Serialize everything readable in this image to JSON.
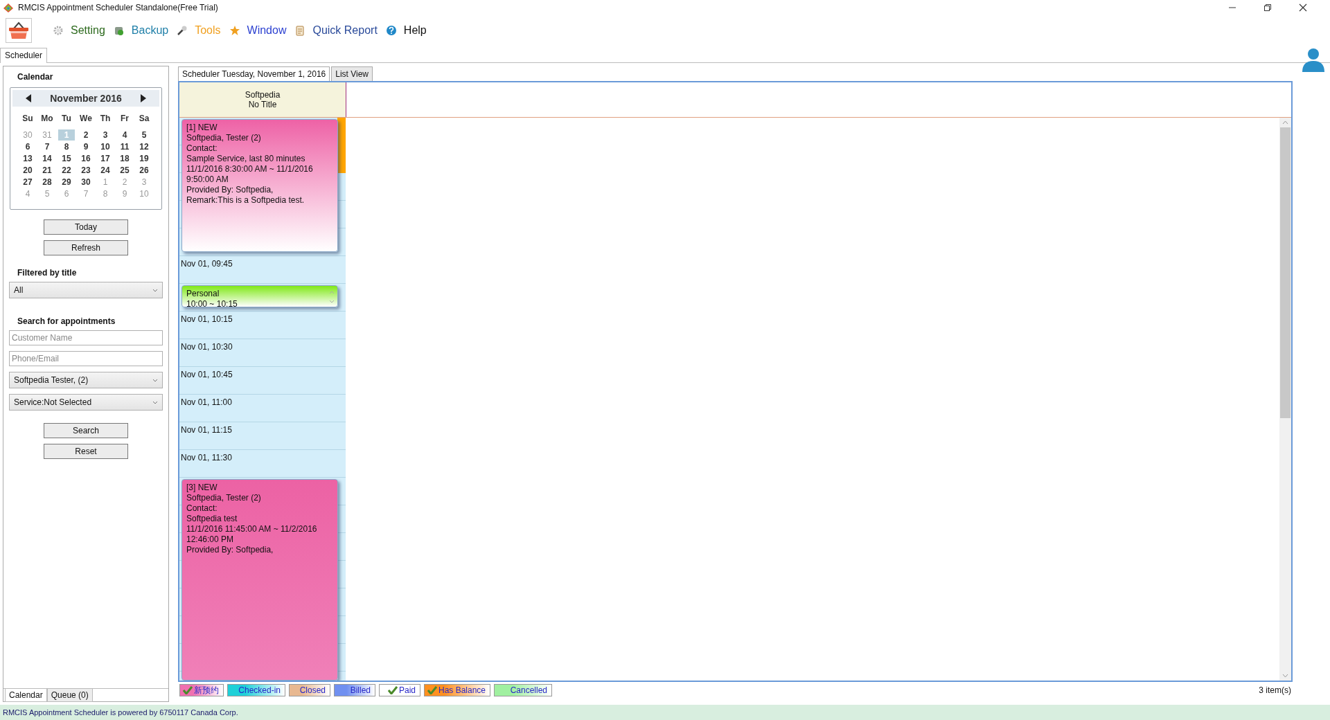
{
  "window": {
    "title": "RMCIS Appointment Scheduler Standalone(Free Trial)"
  },
  "menu": [
    {
      "label": "Setting",
      "color": "#2d6a1e"
    },
    {
      "label": "Backup",
      "color": "#1f7fa8"
    },
    {
      "label": "Tools",
      "color": "#f0a020"
    },
    {
      "label": "Window",
      "color": "#2a3fd0"
    },
    {
      "label": "Quick Report",
      "color": "#2a4a9a"
    },
    {
      "label": "Help",
      "color": "#111111"
    }
  ],
  "main_tabs": [
    {
      "label": "Scheduler",
      "selected": true
    }
  ],
  "calendar": {
    "heading": "Calendar",
    "month": "November 2016",
    "weekdays": [
      "Su",
      "Mo",
      "Tu",
      "We",
      "Th",
      "Fr",
      "Sa"
    ],
    "weeks": [
      [
        {
          "day": "30",
          "other_month": true,
          "selected": false
        },
        {
          "day": "31",
          "other_month": true,
          "selected": false
        },
        {
          "day": "1",
          "other_month": false,
          "selected": true
        },
        {
          "day": "2",
          "other_month": false,
          "selected": false
        },
        {
          "day": "3",
          "other_month": false,
          "selected": false
        },
        {
          "day": "4",
          "other_month": false,
          "selected": false
        },
        {
          "day": "5",
          "other_month": false,
          "selected": false
        }
      ],
      [
        {
          "day": "6",
          "other_month": false,
          "selected": false
        },
        {
          "day": "7",
          "other_month": false,
          "selected": false
        },
        {
          "day": "8",
          "other_month": false,
          "selected": false
        },
        {
          "day": "9",
          "other_month": false,
          "selected": false
        },
        {
          "day": "10",
          "other_month": false,
          "selected": false
        },
        {
          "day": "11",
          "other_month": false,
          "selected": false
        },
        {
          "day": "12",
          "other_month": false,
          "selected": false
        }
      ],
      [
        {
          "day": "13",
          "other_month": false,
          "selected": false
        },
        {
          "day": "14",
          "other_month": false,
          "selected": false
        },
        {
          "day": "15",
          "other_month": false,
          "selected": false
        },
        {
          "day": "16",
          "other_month": false,
          "selected": false
        },
        {
          "day": "17",
          "other_month": false,
          "selected": false
        },
        {
          "day": "18",
          "other_month": false,
          "selected": false
        },
        {
          "day": "19",
          "other_month": false,
          "selected": false
        }
      ],
      [
        {
          "day": "20",
          "other_month": false,
          "selected": false
        },
        {
          "day": "21",
          "other_month": false,
          "selected": false
        },
        {
          "day": "22",
          "other_month": false,
          "selected": false
        },
        {
          "day": "23",
          "other_month": false,
          "selected": false
        },
        {
          "day": "24",
          "other_month": false,
          "selected": false
        },
        {
          "day": "25",
          "other_month": false,
          "selected": false
        },
        {
          "day": "26",
          "other_month": false,
          "selected": false
        }
      ],
      [
        {
          "day": "27",
          "other_month": false,
          "selected": false
        },
        {
          "day": "28",
          "other_month": false,
          "selected": false
        },
        {
          "day": "29",
          "other_month": false,
          "selected": false
        },
        {
          "day": "30",
          "other_month": false,
          "selected": false
        },
        {
          "day": "1",
          "other_month": true,
          "selected": false
        },
        {
          "day": "2",
          "other_month": true,
          "selected": false
        },
        {
          "day": "3",
          "other_month": true,
          "selected": false
        }
      ],
      [
        {
          "day": "4",
          "other_month": true,
          "selected": false
        },
        {
          "day": "5",
          "other_month": true,
          "selected": false
        },
        {
          "day": "6",
          "other_month": true,
          "selected": false
        },
        {
          "day": "7",
          "other_month": true,
          "selected": false
        },
        {
          "day": "8",
          "other_month": true,
          "selected": false
        },
        {
          "day": "9",
          "other_month": true,
          "selected": false
        },
        {
          "day": "10",
          "other_month": true,
          "selected": false
        }
      ]
    ]
  },
  "today_button": "Today",
  "refresh_button": "Refresh",
  "filter": {
    "label": "Filtered by title",
    "value": "All"
  },
  "search": {
    "label": "Search for appointments",
    "customer_placeholder": "Customer Name",
    "contact_placeholder": "Phone/Email",
    "staff_value": "Softpedia Tester, (2)",
    "service_value": "Service:Not Selected",
    "search_button": "Search",
    "reset_button": "Reset"
  },
  "left_tabs": [
    {
      "label": "Calendar",
      "selected": true
    },
    {
      "label": "Queue (0)",
      "selected": false
    }
  ],
  "view_tabs": [
    {
      "label": "Scheduler Tuesday, November 1, 2016",
      "selected": true
    },
    {
      "label": "List View",
      "selected": false
    }
  ],
  "resource": {
    "name": "Softpedia",
    "title": "No Title"
  },
  "timeline": [
    {
      "kind": "new",
      "highlighted": true,
      "lines": [
        "[1] NEW",
        "Softpedia, Tester (2)",
        "Contact:",
        "Sample Service, last 80 minutes",
        "11/1/2016 8:30:00 AM ~ 11/1/2016",
        "9:50:00 AM",
        "Provided By: Softpedia,",
        "Remark:This is a Softpedia test."
      ]
    },
    {
      "kind": "time",
      "label": "Nov 01, 09:45"
    },
    {
      "kind": "personal",
      "highlighted": false,
      "lines": [
        "Personal",
        "10:00 ~ 10:15"
      ]
    },
    {
      "kind": "time",
      "label": "Nov 01, 10:15"
    },
    {
      "kind": "time",
      "label": "Nov 01, 10:30"
    },
    {
      "kind": "time",
      "label": "Nov 01, 10:45"
    },
    {
      "kind": "time",
      "label": "Nov 01, 11:00"
    },
    {
      "kind": "time",
      "label": "Nov 01, 11:15"
    },
    {
      "kind": "time",
      "label": "Nov 01, 11:30"
    },
    {
      "kind": "booking",
      "highlighted": false,
      "lines": [
        "[3] NEW",
        "Softpedia, Tester (2)",
        "Contact:",
        "Softpedia test",
        "11/1/2016 11:45:00 AM ~ 11/2/2016",
        "12:46:00 PM",
        "Provided By: Softpedia,"
      ]
    }
  ],
  "legend": [
    {
      "label": "新预约",
      "checked": true,
      "color": "#f070b0"
    },
    {
      "label": "Checked-in",
      "checked": false,
      "color": "#20d0d8"
    },
    {
      "label": "Closed",
      "checked": false,
      "color": "#e8b890"
    },
    {
      "label": "Billed",
      "checked": false,
      "color": "#7090f0"
    },
    {
      "label": "Paid",
      "checked": true,
      "color": "#ffffff"
    },
    {
      "label": "Has Balance",
      "checked": true,
      "color": "#ff9020"
    },
    {
      "label": "Cancelled",
      "checked": false,
      "color": "#a0f0a0"
    }
  ],
  "item_count": "3 item(s)",
  "status_bar": "RMCIS Appointment Scheduler is powered by 6750117 Canada Corp."
}
